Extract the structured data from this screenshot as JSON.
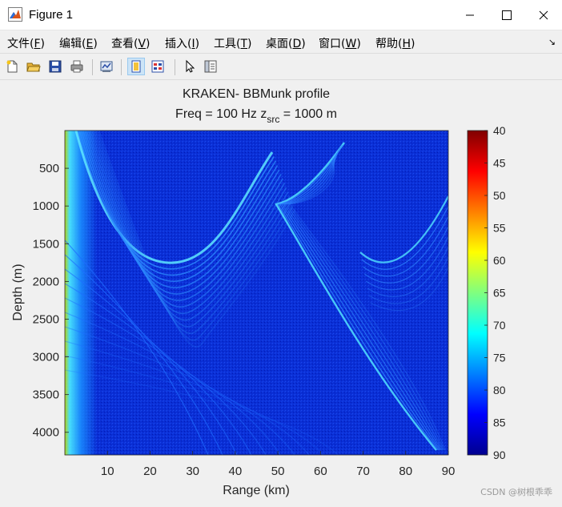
{
  "window": {
    "title": "Figure 1",
    "icon": "matlab-figure-icon",
    "controls": [
      "minimize-icon",
      "maximize-icon",
      "close-icon"
    ]
  },
  "menu": {
    "items": [
      {
        "label": "文件(",
        "key": "F",
        "suffix": ")"
      },
      {
        "label": "编辑(",
        "key": "E",
        "suffix": ")"
      },
      {
        "label": "查看(",
        "key": "V",
        "suffix": ")"
      },
      {
        "label": "插入(",
        "key": "I",
        "suffix": ")"
      },
      {
        "label": "工具(",
        "key": "T",
        "suffix": ")"
      },
      {
        "label": "桌面(",
        "key": "D",
        "suffix": ")"
      },
      {
        "label": "窗口(",
        "key": "W",
        "suffix": ")"
      },
      {
        "label": "帮助(",
        "key": "H",
        "suffix": ")"
      }
    ],
    "overflow_glyph": "↘"
  },
  "toolbar": {
    "buttons": [
      "new-figure-icon",
      "open-file-icon",
      "save-icon",
      "print-icon",
      "link-plot-icon",
      "hide-plot-tools-icon",
      "show-plot-tools-icon",
      "edit-plot-pointer-icon",
      "property-inspector-icon"
    ],
    "active": [
      "hide-plot-tools-icon"
    ]
  },
  "chart_data": {
    "type": "heatmap",
    "title": "KRAKEN- BBMunk profile",
    "subtitle_prefix": "Freq = 100 Hz    z",
    "subtitle_subscript": "src",
    "subtitle_suffix": " = 1000 m",
    "xlabel": "Range (km)",
    "ylabel": "Depth (m)",
    "xlim": [
      0,
      90
    ],
    "ylim": [
      0,
      4300
    ],
    "y_reversed": true,
    "xticks": [
      10,
      20,
      30,
      40,
      50,
      60,
      70,
      80,
      90
    ],
    "yticks": [
      500,
      1000,
      1500,
      2000,
      2500,
      3000,
      3500,
      4000
    ],
    "colorbar": {
      "colormap": "jet",
      "reversed": true,
      "clim": [
        40,
        90
      ],
      "ticks": [
        40,
        45,
        50,
        55,
        60,
        65,
        70,
        75,
        80,
        85,
        90
      ]
    },
    "background_color": "#0a2fd6"
  },
  "watermark": "CSDN @树根乖乖"
}
